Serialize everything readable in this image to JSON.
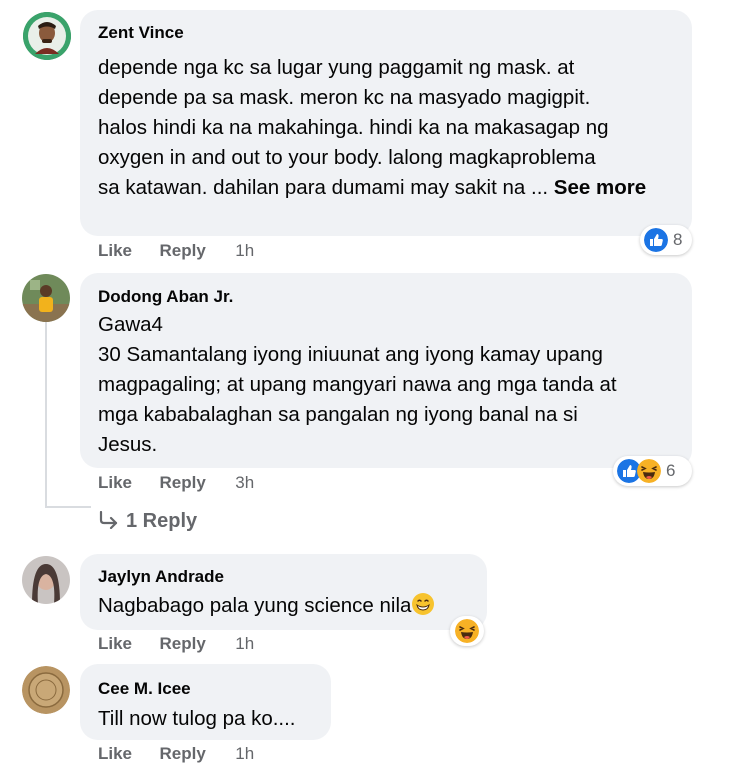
{
  "comments": [
    {
      "author": "Zent Vince",
      "lines": [
        "depende nga kc sa lugar yung paggamit ng mask. at",
        "depende pa sa mask. meron kc na masyado magigpit.",
        "halos hindi ka na makahinga. hindi ka na makasagap ng",
        "oxygen in and out to your body. lalong magkaproblema",
        "sa katawan. dahilan para dumami may sakit na ..."
      ],
      "see_more": "See more",
      "like_label": "Like",
      "reply_label": "Reply",
      "time": "1h",
      "reaction_count": "8"
    },
    {
      "author": "Dodong Aban Jr.",
      "lines": [
        "Gawa4",
        "30 Samantalang iyong iniuunat ang iyong kamay upang",
        "magpagaling; at upang mangyari nawa ang mga tanda at",
        "mga kababalaghan sa pangalan ng iyong banal na si",
        "Jesus."
      ],
      "like_label": "Like",
      "reply_label": "Reply",
      "time": "3h",
      "reaction_count": "6",
      "replies_label": "1 Reply"
    },
    {
      "author": "Jaylyn Andrade",
      "lines": [
        "Nagbabago pala yung science nila"
      ],
      "like_label": "Like",
      "reply_label": "Reply",
      "time": "1h"
    },
    {
      "author": "Cee M. Icee",
      "lines": [
        "Till now tulog pa ko...."
      ],
      "like_label": "Like",
      "reply_label": "Reply",
      "time": "1h"
    }
  ],
  "icons": {
    "like_reaction": "like-thumb-icon",
    "haha_reaction": "haha-face-icon",
    "reply_arrow": "reply-arrow-icon"
  },
  "colors": {
    "bubble": "#f0f2f5",
    "like_blue": "#1b74e4",
    "haha_yellow": "#f7b125",
    "meta_gray": "#65676b"
  }
}
